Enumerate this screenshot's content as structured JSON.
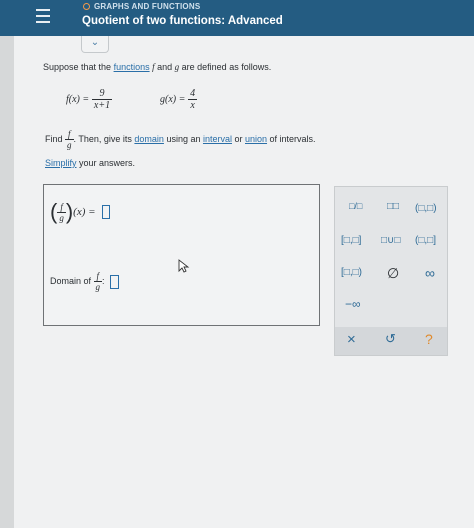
{
  "header": {
    "topic": "GRAPHS AND FUNCTIONS",
    "title": "Quotient of two functions: Advanced"
  },
  "problem": {
    "intro_pre": "Suppose that the ",
    "intro_link": "functions",
    "intro_f": "f",
    "intro_mid": " and ",
    "intro_g": "g",
    "intro_post": " are defined as follows.",
    "f_lhs": "f(x) =",
    "f_num": "9",
    "f_den": "x+1",
    "g_lhs": "g(x) =",
    "g_num": "4",
    "g_den": "x",
    "find_word": "Find",
    "find_num": "f",
    "find_den": "g",
    "find_then": ". Then, give its ",
    "domain_link": "domain",
    "using": " using an ",
    "interval_link": "interval",
    "or": " or ",
    "union_link": "union",
    "of_intervals": " of intervals.",
    "simplify_link": "Simplify",
    "your_answers": " your answers."
  },
  "answer": {
    "quot_num": "f",
    "quot_den": "g",
    "quot_arg": "(x) =",
    "domain_label": "Domain of",
    "domain_num": "f",
    "domain_den": "g",
    "domain_colon": ":"
  },
  "palette": {
    "fraction": "□/□",
    "power": "□□",
    "open_open": "(□,□)",
    "closed_closed": "[□,□]",
    "union": "□∪□",
    "open_closed": "(□,□]",
    "closed_open": "[□,□)",
    "empty_set": "∅",
    "infinity": "∞",
    "neg_infinity": "−∞",
    "clear": "×",
    "undo": "↺",
    "help": "?"
  }
}
